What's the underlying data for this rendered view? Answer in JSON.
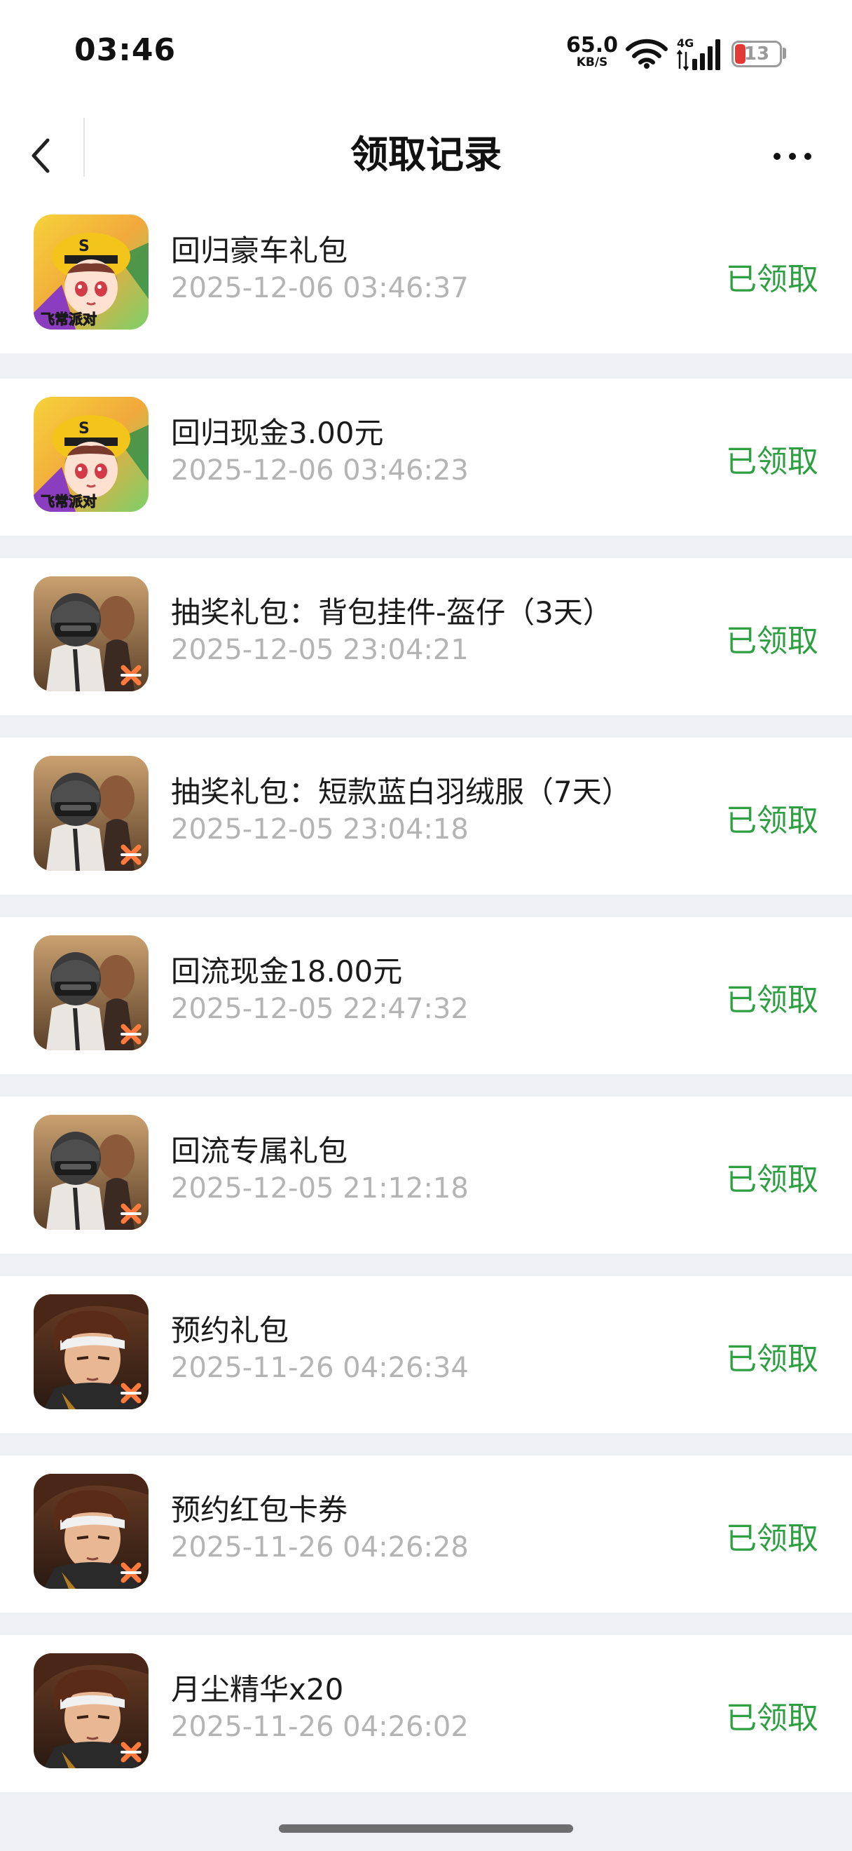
{
  "status_bar": {
    "time": "03:46",
    "net_speed_value": "65.0",
    "net_speed_unit": "KB/S",
    "network_type": "4G",
    "battery_level": "13",
    "icons": [
      "wifi-icon",
      "cellular-signal-icon",
      "battery-icon"
    ]
  },
  "nav": {
    "title": "领取记录",
    "icons": [
      "back-chevron-icon",
      "more-dots-icon"
    ]
  },
  "records": [
    {
      "name": "回归豪车礼包",
      "time": "2025-12-06 03:46:37",
      "status": "已领取",
      "game_icon": "racing-game-icon"
    },
    {
      "name": "回归现金3.00元",
      "time": "2025-12-06 03:46:23",
      "status": "已领取",
      "game_icon": "racing-game-icon"
    },
    {
      "name": "抽奖礼包：背包挂件-盔仔（3天）",
      "time": "2025-12-05 23:04:21",
      "status": "已领取",
      "game_icon": "shooter-game-icon"
    },
    {
      "name": "抽奖礼包：短款蓝白羽绒服（7天）",
      "time": "2025-12-05 23:04:18",
      "status": "已领取",
      "game_icon": "shooter-game-icon"
    },
    {
      "name": "回流现金18.00元",
      "time": "2025-12-05 22:47:32",
      "status": "已领取",
      "game_icon": "shooter-game-icon"
    },
    {
      "name": "回流专属礼包",
      "time": "2025-12-05 21:12:18",
      "status": "已领取",
      "game_icon": "shooter-game-icon"
    },
    {
      "name": "预约礼包",
      "time": "2025-11-26 04:26:34",
      "status": "已领取",
      "game_icon": "fighter-game-icon"
    },
    {
      "name": "预约红包卡券",
      "time": "2025-11-26 04:26:28",
      "status": "已领取",
      "game_icon": "fighter-game-icon"
    },
    {
      "name": "月尘精华x20",
      "time": "2025-11-26 04:26:02",
      "status": "已领取",
      "game_icon": "fighter-game-icon"
    }
  ],
  "icon_logos": {
    "racing": "飞常派对"
  },
  "colors": {
    "claimed_status": "#2fa042",
    "timestamp": "#b4b4b4",
    "page_background": "#eff0f4"
  }
}
